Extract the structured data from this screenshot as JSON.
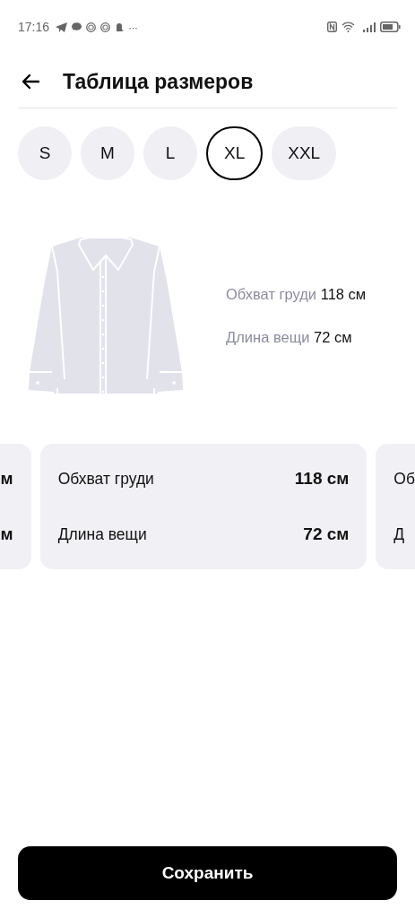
{
  "status_bar": {
    "time": "17:16",
    "more": "···"
  },
  "header": {
    "title": "Таблица размеров"
  },
  "sizes": [
    {
      "label": "S",
      "selected": false
    },
    {
      "label": "M",
      "selected": false
    },
    {
      "label": "L",
      "selected": false
    },
    {
      "label": "XL",
      "selected": true
    },
    {
      "label": "XXL",
      "selected": false
    }
  ],
  "preview": {
    "rows": [
      {
        "label": "Обхват груди",
        "value": "118 см"
      },
      {
        "label": "Длина вещи",
        "value": "72 см"
      }
    ]
  },
  "cards": [
    {
      "kind": "prev",
      "rows": [
        {
          "value": "м"
        },
        {
          "value": "м"
        }
      ]
    },
    {
      "kind": "current",
      "rows": [
        {
          "label": "Обхват груди",
          "value": "118 см"
        },
        {
          "label": "Длина вещи",
          "value": "72 см"
        }
      ]
    },
    {
      "kind": "next",
      "rows": [
        {
          "label": "Об"
        },
        {
          "label": "Д"
        }
      ]
    }
  ],
  "save_button": "Сохранить"
}
